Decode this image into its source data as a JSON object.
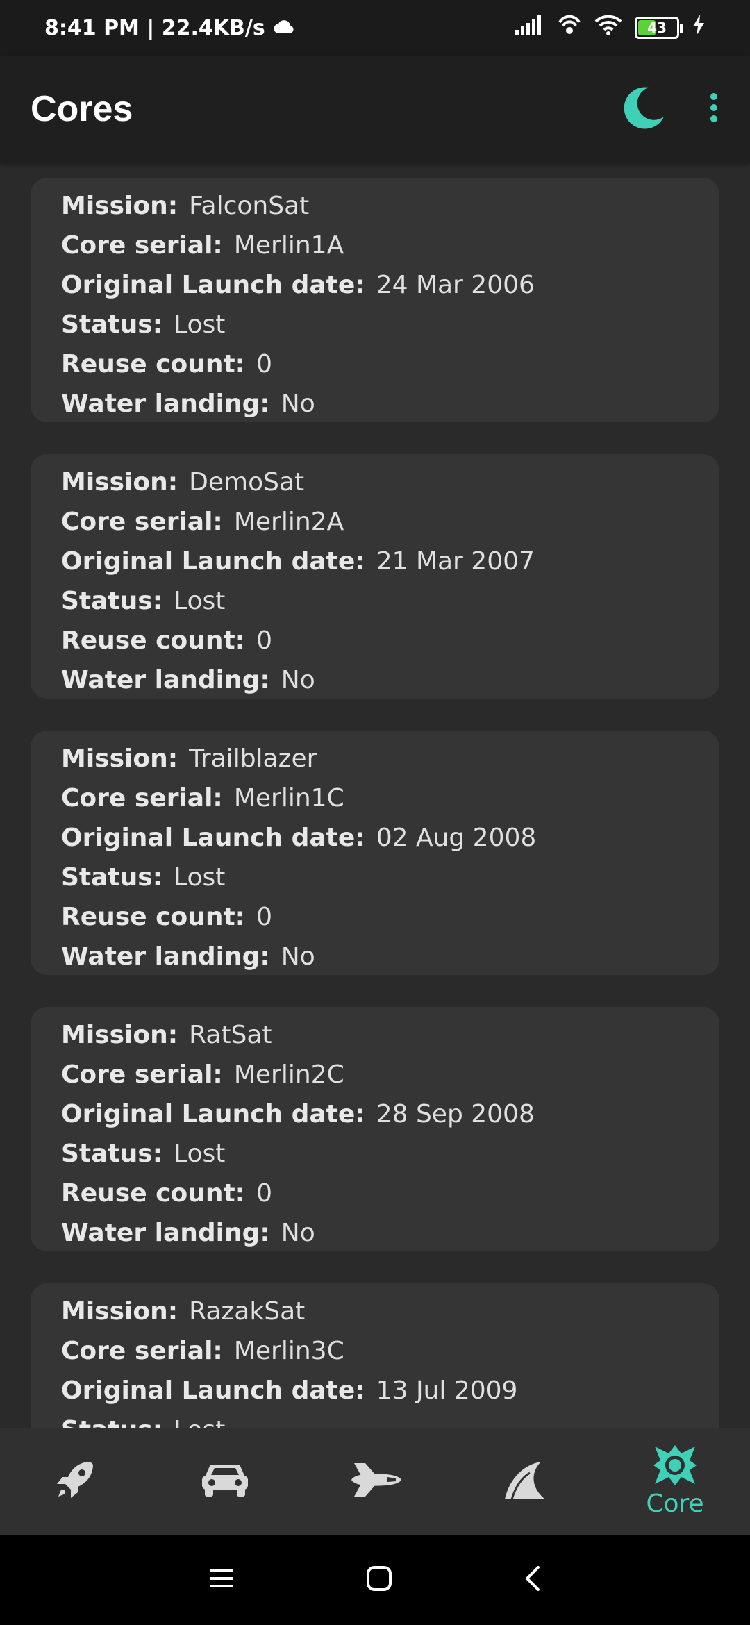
{
  "status_bar": {
    "time_speed": "8:41 PM | 22.4KB/s",
    "battery_level": "43"
  },
  "app_bar": {
    "title": "Cores",
    "theme_icon": "moon-icon",
    "menu_icon": "more-vert-icon",
    "accent_color": "#3fd1b7"
  },
  "labels": {
    "mission": "Mission:",
    "core_serial": "Core serial:",
    "launch_date": "Original Launch date:",
    "status": "Status:",
    "reuse_count": "Reuse count:",
    "water_landing": "Water landing:"
  },
  "cores": [
    {
      "mission": "FalconSat",
      "core_serial": "Merlin1A",
      "launch_date": "24 Mar 2006",
      "status": "Lost",
      "reuse_count": "0",
      "water_landing": "No"
    },
    {
      "mission": "DemoSat",
      "core_serial": "Merlin2A",
      "launch_date": "21 Mar 2007",
      "status": "Lost",
      "reuse_count": "0",
      "water_landing": "No"
    },
    {
      "mission": "Trailblazer",
      "core_serial": "Merlin1C",
      "launch_date": "02 Aug 2008",
      "status": "Lost",
      "reuse_count": "0",
      "water_landing": "No"
    },
    {
      "mission": "RatSat",
      "core_serial": "Merlin2C",
      "launch_date": "28 Sep 2008",
      "status": "Lost",
      "reuse_count": "0",
      "water_landing": "No"
    },
    {
      "mission": "RazakSat",
      "core_serial": "Merlin3C",
      "launch_date": "13 Jul 2009",
      "status": "Lost",
      "reuse_count": "",
      "water_landing": ""
    }
  ],
  "bottom_nav": {
    "items": [
      {
        "icon": "rocket-icon"
      },
      {
        "icon": "car-icon"
      },
      {
        "icon": "shuttle-icon"
      },
      {
        "icon": "fin-icon"
      },
      {
        "icon": "core-icon",
        "label": "Core",
        "active": true
      }
    ]
  }
}
